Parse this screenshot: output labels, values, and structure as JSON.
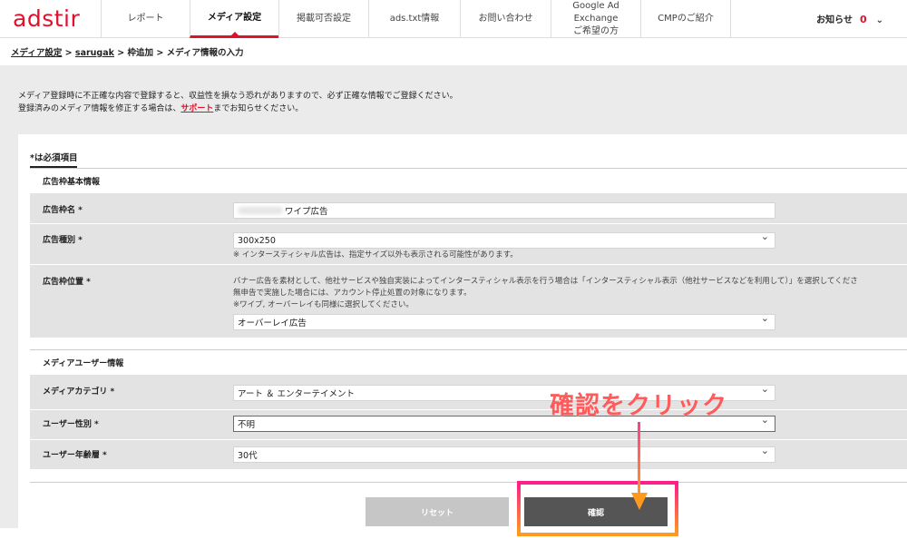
{
  "header": {
    "logo": "adstir",
    "nav": [
      {
        "label": "レポート"
      },
      {
        "label": "メディア設定"
      },
      {
        "label": "掲載可否設定"
      },
      {
        "label": "ads.txt情報"
      },
      {
        "label": "お問い合わせ"
      },
      {
        "label": "Google Ad\nExchange\nご希望の方"
      },
      {
        "label": "CMPのご紹介"
      }
    ],
    "active_index": 1,
    "notice_label": "お知らせ",
    "notice_count": "0"
  },
  "breadcrumb": {
    "media": "メディア設定",
    "sep1": " > ",
    "site": "sarugak",
    "rest": " > 枠追加 > メディア情報の入力"
  },
  "intro": {
    "line1": "メディア登録時に不正確な内容で登録すると、収益性を損なう恐れがありますので、必ず正確な情報でご登録ください。",
    "line2_pre": "登録済みのメディア情報を修正する場合は、",
    "support_link": "サポート",
    "line2_post": "までお知らせください。"
  },
  "form": {
    "required_note": "*は必須項目",
    "section1_title": "広告枠基本情報",
    "ad_name_label": "広告枠名 *",
    "ad_name_value": "ワイプ広告",
    "ad_type_label": "広告種別 *",
    "ad_type_value": "300x250",
    "ad_type_hint": "※ インタースティシャル広告は、指定サイズ以外も表示される可能性があります。",
    "ad_position_label": "広告枠位置 *",
    "ad_position_hint1": "バナー広告を素材として、他社サービスや独自実装によってインタースティシャル表示を行う場合は「インタースティシャル表示（他社サービスなどを利用して）」を選択してくださ",
    "ad_position_hint2": "無申告で実施した場合には、アカウント停止処置の対象になります。",
    "ad_position_hint3": "※ワイプ, オーバーレイも同様に選択してください。",
    "ad_position_value": "オーバーレイ広告",
    "section2_title": "メディアユーザー情報",
    "category_label": "メディアカテゴリ *",
    "category_value": "アート ＆ エンターテイメント",
    "gender_label": "ユーザー性別 *",
    "gender_value": "不明",
    "age_label": "ユーザー年齢層 *",
    "age_value": "30代"
  },
  "buttons": {
    "reset": "リセット",
    "confirm": "確認"
  },
  "annotation": {
    "text": "確認をクリック"
  },
  "colors": {
    "brand": "#e0112b",
    "annotation": "#ff5b5b",
    "highlight_top": "#ff1f8a",
    "highlight_bottom": "#ff9a1f"
  }
}
